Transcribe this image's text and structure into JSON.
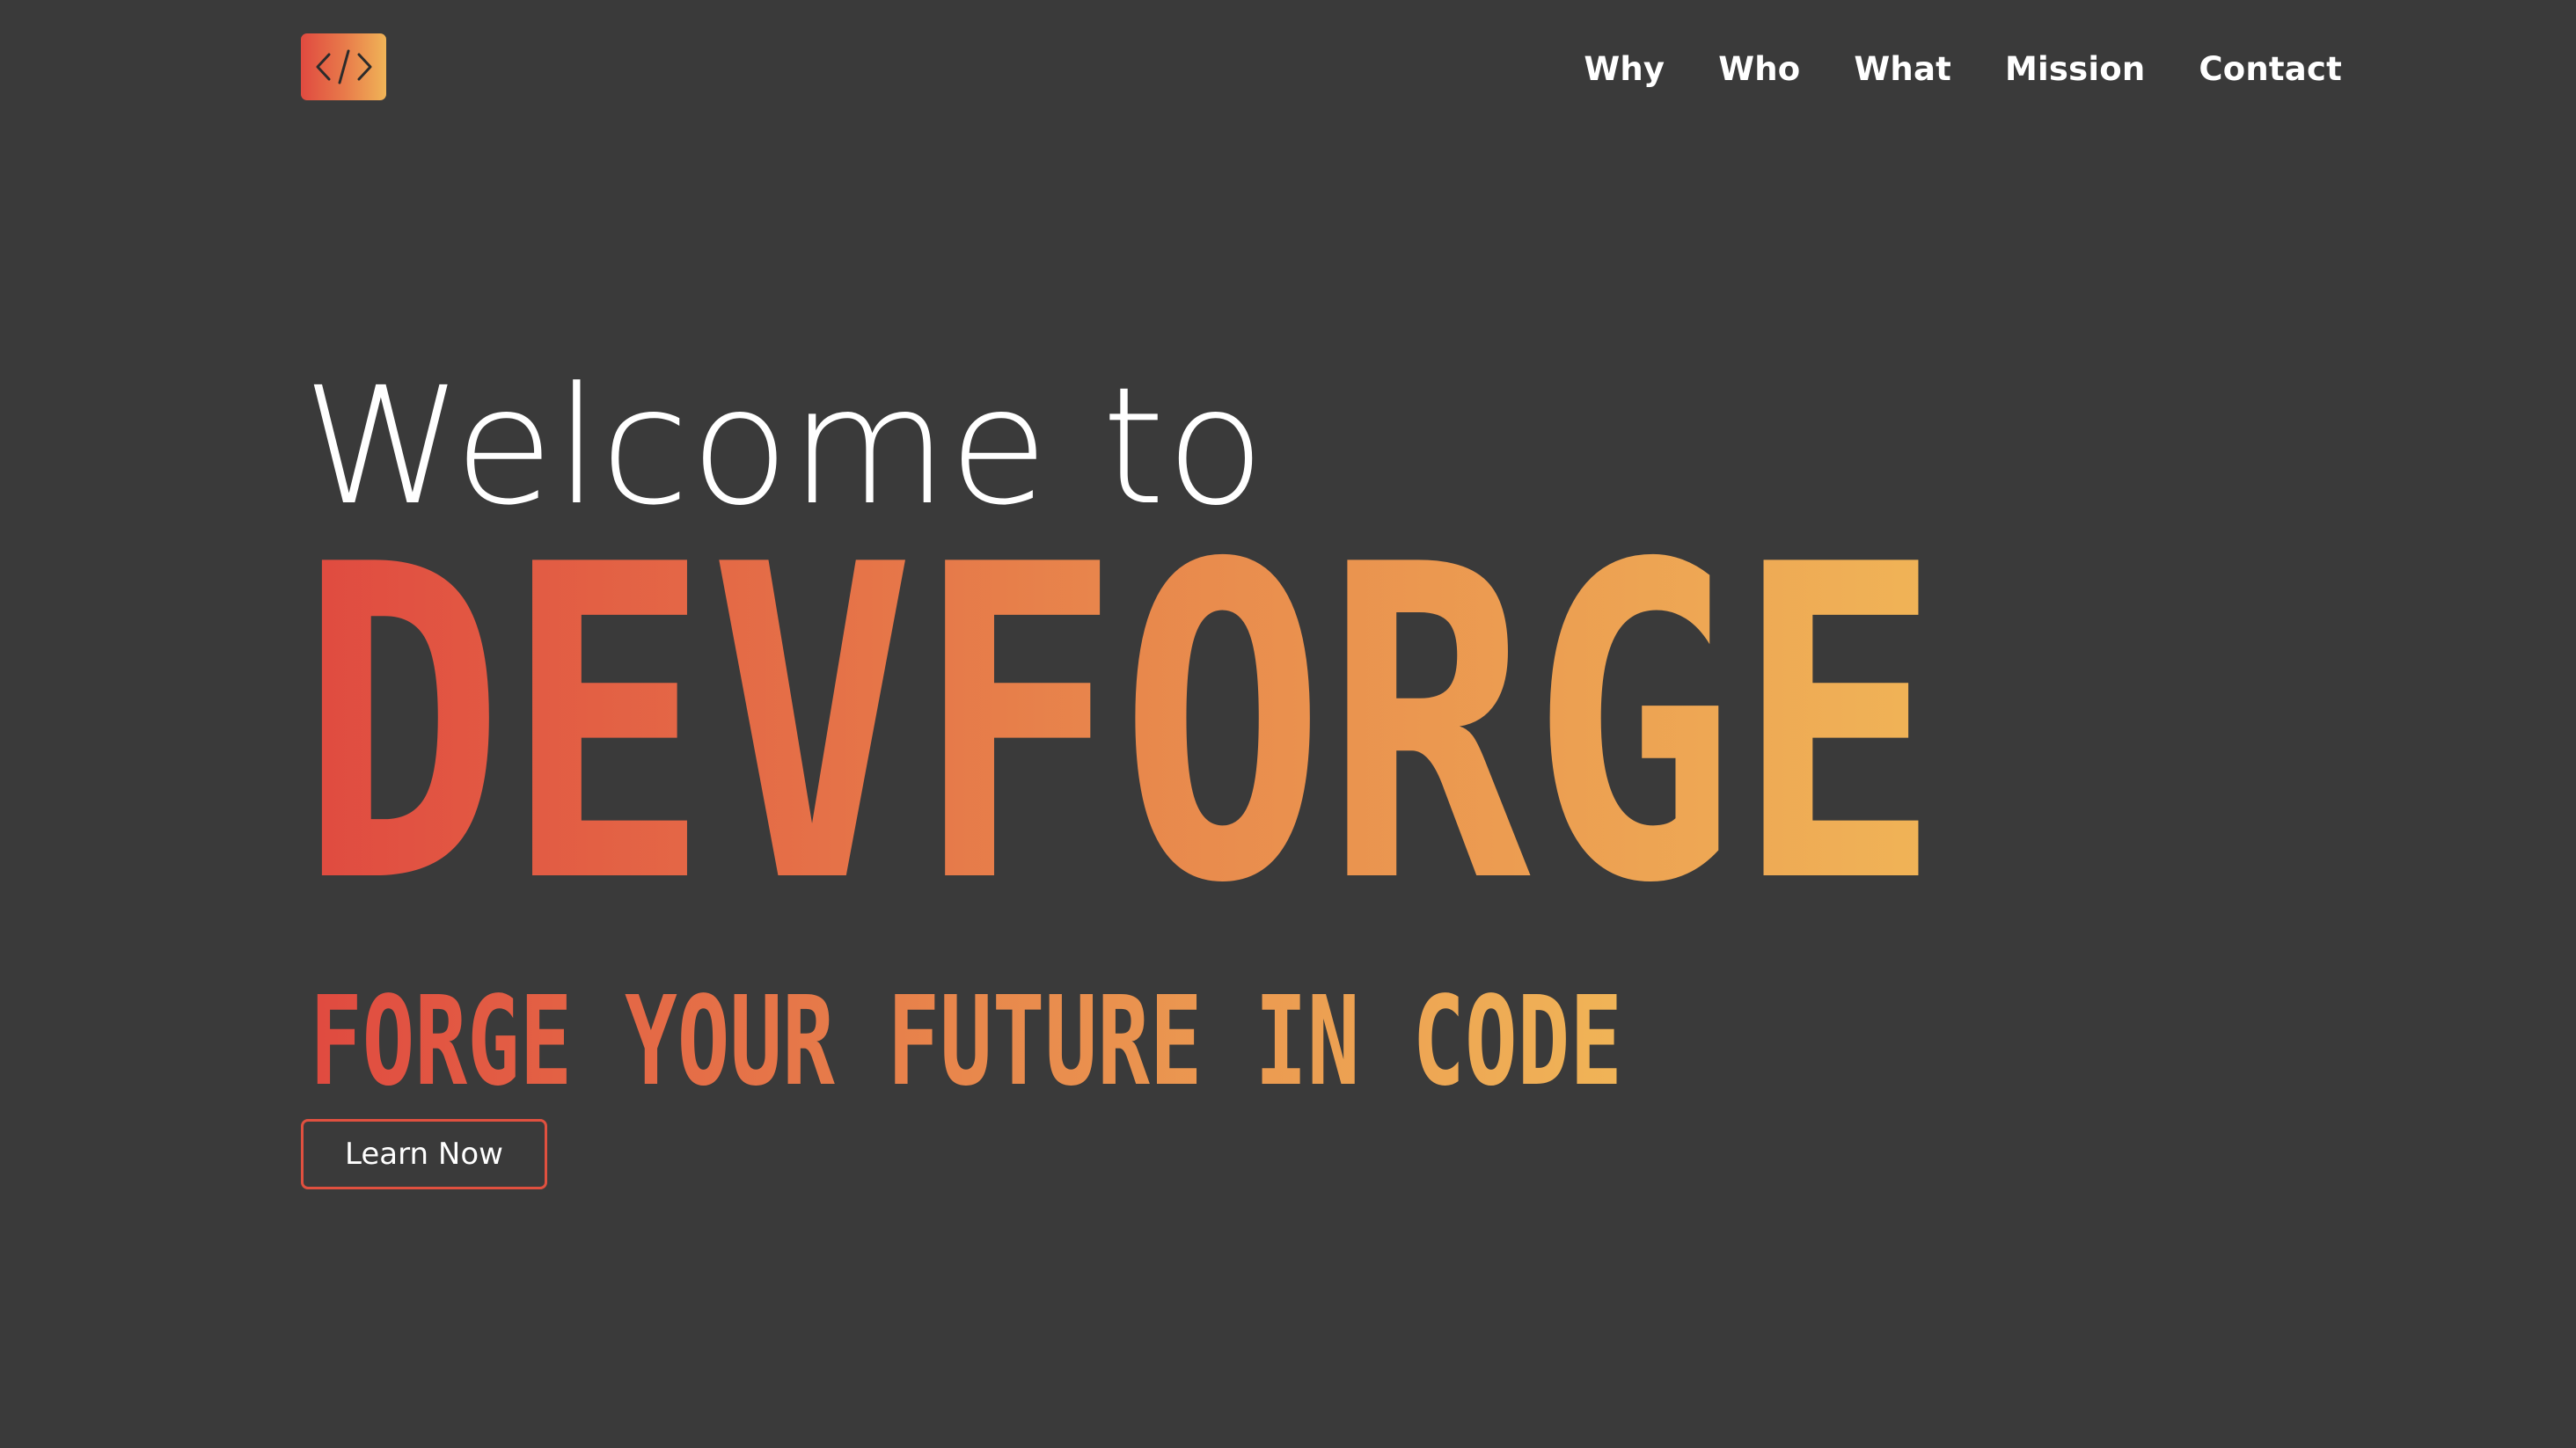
{
  "header": {
    "logo_icon": "code-brackets-icon",
    "logo_glyph": "</>",
    "nav": [
      {
        "label": "Why"
      },
      {
        "label": "Who"
      },
      {
        "label": "What"
      },
      {
        "label": "Mission"
      },
      {
        "label": "Contact"
      }
    ]
  },
  "hero": {
    "welcome": "Welcome to",
    "title": "DEVFORGE",
    "tagline": "FORGE YOUR FUTURE IN CODE",
    "cta_label": "Learn Now"
  },
  "colors": {
    "background": "#3a3a3a",
    "gradient_start": "#e04a40",
    "gradient_mid": "#e8794a",
    "gradient_end": "#f0b457",
    "text": "#ffffff",
    "button_border": "#e0503f"
  }
}
